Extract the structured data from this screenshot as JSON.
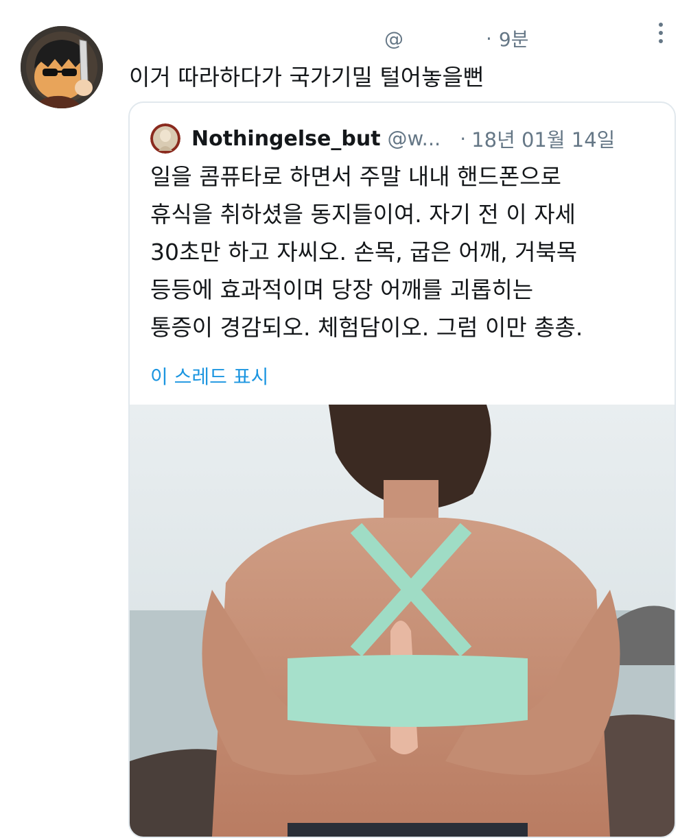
{
  "tweet": {
    "handle": "@",
    "separator": "·",
    "time": "9분",
    "text": "이거 따라하다가 국가기밀 털어놓을뻔"
  },
  "quoted": {
    "name": "Nothingelse_but",
    "handle": "@w...",
    "separator": "·",
    "date": "18년 01월 14일",
    "lines": [
      "일을 콤퓨타로 하면서 주말 내내 핸드폰으로",
      "휴식을 취하셨을  동지들이여. 자기 전 이 자세",
      "30초만 하고 자씨오.  손목, 굽은 어깨, 거북목",
      "등등에 효과적이며 당장 어깨를 괴롭히는",
      "통증이 경감되오. 체험담이오. 그럼 이만 총총."
    ],
    "show_thread": "이 스레드 표시"
  },
  "icons": {
    "more": "more-vertical-icon",
    "avatar": "avatar-cartoon-knife",
    "quoted_avatar": "avatar-portrait"
  },
  "colors": {
    "secondary_text": "#657786",
    "link": "#1b95e0",
    "border": "#e1e8ed"
  }
}
